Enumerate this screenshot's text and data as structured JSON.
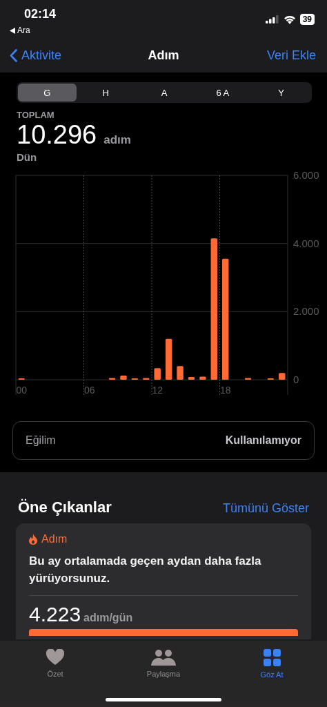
{
  "status_bar": {
    "time": "02:14",
    "back_app": "Ara",
    "battery": "39"
  },
  "nav": {
    "back": "Aktivite",
    "title": "Adım",
    "action": "Veri Ekle"
  },
  "segments": [
    {
      "label": "G",
      "selected": true
    },
    {
      "label": "H",
      "selected": false
    },
    {
      "label": "A",
      "selected": false
    },
    {
      "label": "6 A",
      "selected": false
    },
    {
      "label": "Y",
      "selected": false
    }
  ],
  "summary": {
    "label": "TOPLAM",
    "value": "10.296",
    "unit": "adım",
    "date": "Dün"
  },
  "chart_data": {
    "type": "bar",
    "x": [
      0,
      8,
      9,
      10,
      11,
      12,
      13,
      14,
      15,
      16,
      17,
      18,
      20,
      22,
      23
    ],
    "values": [
      20,
      50,
      120,
      40,
      50,
      340,
      1200,
      400,
      80,
      90,
      4150,
      3550,
      50,
      20,
      200
    ],
    "xlim": [
      -0.5,
      23.5
    ],
    "xticks": [
      {
        "value": 0,
        "label": "00"
      },
      {
        "value": 6,
        "label": "06"
      },
      {
        "value": 12,
        "label": "12"
      },
      {
        "value": 18,
        "label": "18"
      }
    ],
    "ylim": [
      0,
      6000
    ],
    "yticks": [
      0,
      {
        "value": 2000,
        "label": "2.000"
      },
      {
        "value": 4000,
        "label": "4.000"
      },
      {
        "value": 6000,
        "label": "6.000"
      }
    ]
  },
  "trend": {
    "label": "Eğilim",
    "value": "Kullanılamıyor"
  },
  "highlights": {
    "title": "Öne Çıkanlar",
    "link": "Tümünü Göster",
    "card": {
      "category": "Adım",
      "text": "Bu ay ortalamada geçen aydan daha fazla yürüyorsunuz.",
      "value": "4.223",
      "unit": "adım/gün"
    }
  },
  "tabs": [
    {
      "label": "Özet",
      "kind": "heart",
      "selected": false
    },
    {
      "label": "Paylaşma",
      "kind": "people",
      "selected": false
    },
    {
      "label": "Göz At",
      "kind": "grid",
      "selected": true
    }
  ]
}
